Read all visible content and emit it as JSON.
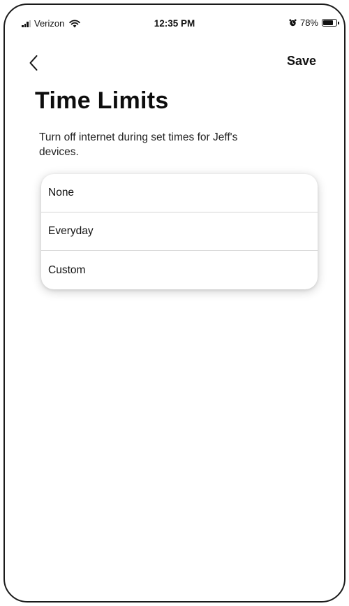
{
  "status_bar": {
    "carrier": "Verizon",
    "time": "12:35 PM",
    "battery_percent": "78%",
    "battery_level": 0.78,
    "icons": [
      "signal-icon",
      "wifi-icon",
      "alarm-icon",
      "battery-icon"
    ]
  },
  "nav": {
    "back_icon": "chevron-left-icon",
    "save_label": "Save"
  },
  "page": {
    "title": "Time Limits",
    "description": "Turn off internet during set times for Jeff's devices."
  },
  "options": [
    {
      "label": "None"
    },
    {
      "label": "Everyday"
    },
    {
      "label": "Custom"
    }
  ]
}
